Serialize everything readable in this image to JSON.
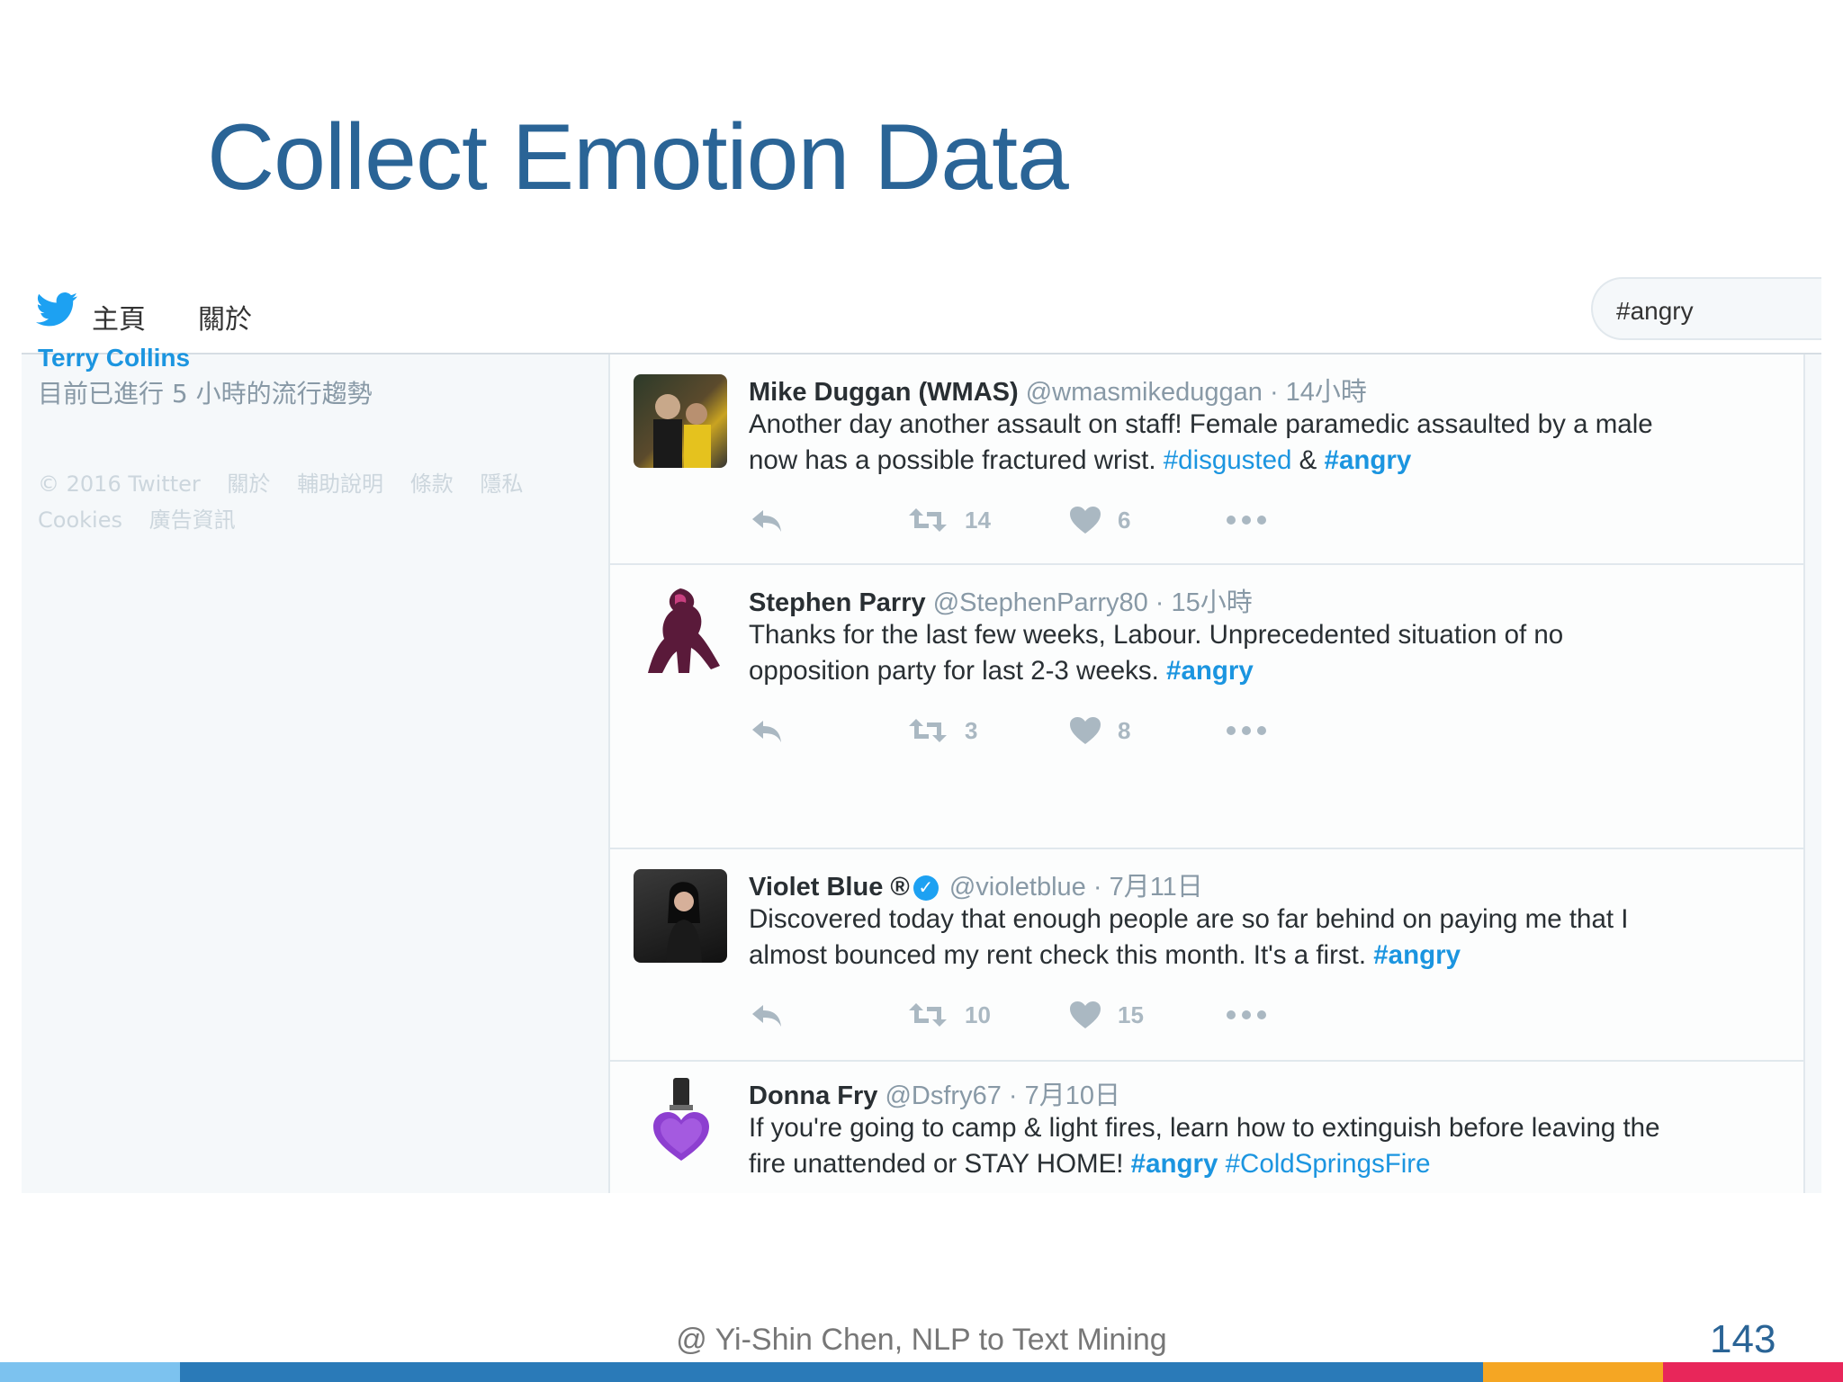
{
  "slide": {
    "title": "Collect Emotion Data",
    "credit": "@ Yi-Shin Chen, NLP to Text Mining",
    "page_number": "143",
    "bar_colors": [
      "#7cc2ef",
      "#2a7ab8",
      "#f5a623",
      "#e8265a"
    ]
  },
  "twitter": {
    "nav": {
      "home": "主頁",
      "about": "關於"
    },
    "search_value": "#angry",
    "sidebar": {
      "cut_name": "Terry Collins",
      "trend_info": "目前已進行 5 小時的流行趨勢",
      "footer_line1": [
        "© 2016 Twitter",
        "關於",
        "輔助說明",
        "條款",
        "隱私"
      ],
      "footer_line2": [
        "Cookies",
        "廣告資訊"
      ]
    },
    "tweets": [
      {
        "name": "Mike Duggan (WMAS)",
        "handle": "@wmasmikeduggan",
        "time": "· 14小時",
        "text_1": "Another day another assault on staff! Female paramedic assaulted by a male",
        "text_2": "now has a possible fractured wrist. ",
        "tag_1": "#disgusted",
        "mid": " & ",
        "tag_2": "#angry",
        "retweets": "14",
        "likes": "6"
      },
      {
        "name": "Stephen Parry",
        "handle": "@StephenParry80",
        "time": "· 15小時",
        "text_1": "Thanks for the last few weeks, Labour. Unprecedented situation of no",
        "text_2": "opposition party for last 2-3 weeks. ",
        "tag_1": "#angry",
        "retweets": "3",
        "likes": "8"
      },
      {
        "name": "Violet Blue ®",
        "handle": "@violetblue",
        "time": "· 7月11日",
        "text_1": "Discovered today that enough people are so far behind on paying me that I",
        "text_2": "almost bounced my rent check this month. It's a first. ",
        "tag_1": "#angry",
        "retweets": "10",
        "likes": "15"
      },
      {
        "name": "Donna Fry",
        "handle": "@Dsfry67",
        "time": "· 7月10日",
        "text_1": "If you're going to camp & light fires, learn how to extinguish before leaving the",
        "text_2": "fire unattended or STAY HOME! ",
        "tag_1": "#angry",
        "tag_2": "#ColdSpringsFire"
      }
    ]
  }
}
